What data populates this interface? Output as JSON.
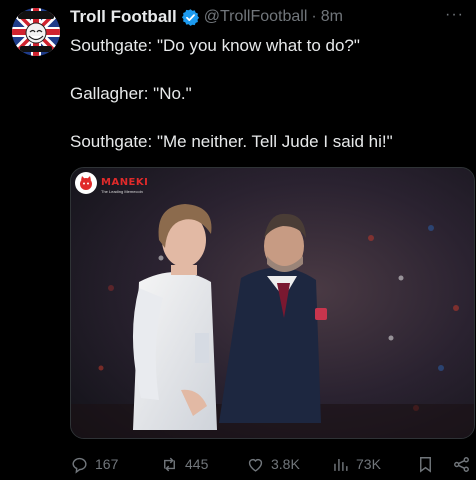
{
  "tweet": {
    "author_name": "Troll Football",
    "handle": "@TrollFootball",
    "separator": "·",
    "time": "8m",
    "more": "···",
    "lines": [
      "Southgate: \"Do you know what to do?\"",
      "Gallagher: \"No.\"",
      "Southgate: \"Me neither. Tell Jude I said hi!\""
    ]
  },
  "avatar": {
    "text_top": "SOCCER",
    "text_bottom": "FOR EVERYONE"
  },
  "media": {
    "watermark_brand": "MANEKI",
    "watermark_tagline": "The Leading Memecoin",
    "description_icon": "photo-image"
  },
  "actions": {
    "replies": "167",
    "reposts": "445",
    "likes": "3.8K",
    "views": "73K"
  },
  "colors": {
    "background": "#000000",
    "text_primary": "#e7e9ea",
    "text_secondary": "#71767b",
    "verified_blue": "#1d9bf0",
    "watermark_red": "#e02a2a"
  }
}
